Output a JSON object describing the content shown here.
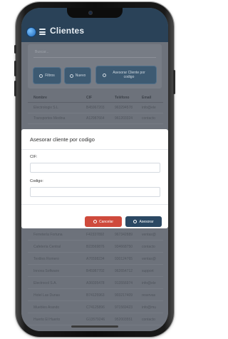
{
  "header": {
    "title": "Clientes"
  },
  "toolbar": {
    "search_placeholder": "Buscar...",
    "filters_label": "Filtros",
    "new_label": "Nuevo",
    "advise_label": "Asesorar Cliente por codigo"
  },
  "table": {
    "columns": [
      "Nombre",
      "CIF",
      "Teléfono",
      "Email"
    ],
    "rows_top": [
      [
        "Electrologix S.L",
        "B45967203",
        "963294578",
        "info@ele"
      ],
      [
        "Transportes Medina",
        "A12987664",
        "961203324",
        "contacto"
      ]
    ],
    "rows_bottom": [
      [
        "Ferretería Fortuna",
        "F42337892",
        "967342889",
        "ventas@"
      ],
      [
        "Cafetería Central",
        "B23569876",
        "934668750",
        "contacto"
      ],
      [
        "Textiles Romero",
        "A76598234",
        "930124765",
        "ventas@"
      ],
      [
        "Innova Software",
        "B45987702",
        "962654712",
        "support"
      ],
      [
        "Electrocol S.A.",
        "A36035478",
        "913556974",
        "info@ele"
      ],
      [
        "Hotel Las Dunas",
        "B74125963",
        "903217409",
        "reservas"
      ],
      [
        "Muebles Arando",
        "C74125896",
        "971569423",
        "info@mu"
      ],
      [
        "Huerto El Huerto",
        "G13579246",
        "952003551",
        "contacto"
      ]
    ]
  },
  "modal": {
    "title": "Asesorar cliente por codigo",
    "cif_label": "CIF:",
    "cif_value": "",
    "code_label": "Codigo:",
    "code_value": "",
    "cancel_label": "Cancelar",
    "submit_label": "Asesorar"
  },
  "colors": {
    "header_bg": "#2a4258",
    "cancel": "#cf4a3c",
    "submit": "#2b4863"
  }
}
